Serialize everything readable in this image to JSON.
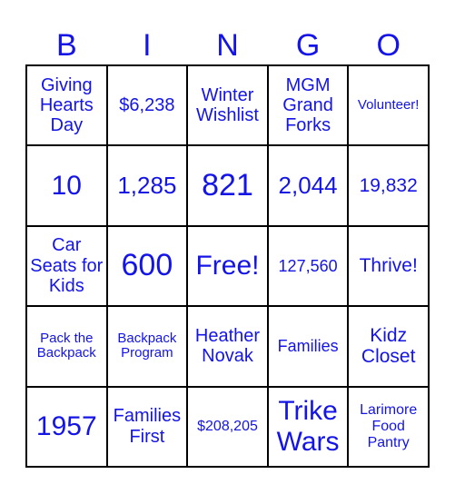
{
  "header": {
    "letters": [
      "B",
      "I",
      "N",
      "G",
      "O"
    ]
  },
  "colors": {
    "text": "#1414e6",
    "grid_lines": "#000000",
    "background": "#ffffff"
  },
  "board": {
    "rows": [
      [
        "Giving Hearts Day",
        "$6,238",
        "Winter Wishlist",
        "MGM Grand Forks",
        "Volunteer!"
      ],
      [
        "10",
        "1,285",
        "821",
        "2,044",
        "19,832"
      ],
      [
        "Car Seats for Kids",
        "600",
        "Free!",
        "127,560",
        "Thrive!"
      ],
      [
        "Pack the Backpack",
        "Backpack Program",
        "Heather Novak",
        "Families",
        "Kidz Closet"
      ],
      [
        "1957",
        "Families First",
        "$208,205",
        "Trike Wars",
        "Larimore Food Pantry"
      ]
    ]
  }
}
